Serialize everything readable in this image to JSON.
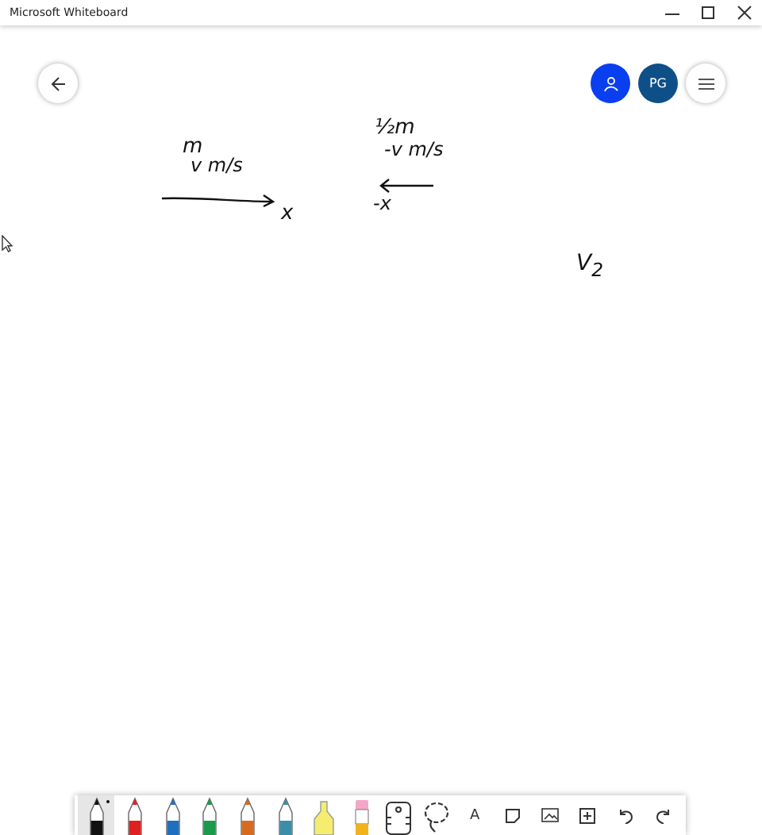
{
  "window": {
    "title": "Microsoft Whiteboard"
  },
  "top_buttons": [
    {
      "kind": "back"
    },
    {
      "kind": "person"
    },
    {
      "kind": "avatar",
      "label": "PG"
    },
    {
      "kind": "menu"
    }
  ],
  "ink": [
    {
      "kind": "text",
      "text": "m"
    },
    {
      "kind": "text",
      "text": "v m/s"
    },
    {
      "kind": "arrow-right"
    },
    {
      "kind": "text",
      "text": "x"
    },
    {
      "kind": "text",
      "text": "½m"
    },
    {
      "kind": "text",
      "text": "-v m/s"
    },
    {
      "kind": "arrow-left"
    },
    {
      "kind": "text",
      "text": "-x"
    },
    {
      "kind": "text",
      "text": "V$_{2}$"
    }
  ],
  "toolbar": [
    {
      "kind": "pen",
      "color": "#111111",
      "selected": true
    },
    {
      "kind": "pen",
      "color": "#e02020",
      "selected": false
    },
    {
      "kind": "pen",
      "color": "#1f6fc0",
      "selected": false
    },
    {
      "kind": "pen",
      "color": "#1a9a4a",
      "selected": false
    },
    {
      "kind": "pen",
      "color": "#d86a20",
      "selected": false
    },
    {
      "kind": "pen",
      "color": "#3a8fa8",
      "selected": false
    },
    {
      "kind": "highlighter",
      "color": "#f5ec70",
      "selected": false
    },
    {
      "kind": "eraser",
      "selected": false
    },
    {
      "kind": "ruler",
      "selected": false
    },
    {
      "kind": "lasso",
      "selected": false
    },
    {
      "kind": "text",
      "label": "A",
      "selected": false
    },
    {
      "kind": "note",
      "selected": false
    },
    {
      "kind": "image",
      "selected": false
    },
    {
      "kind": "add",
      "selected": false
    },
    {
      "kind": "undo",
      "selected": false
    },
    {
      "kind": "redo",
      "selected": false
    }
  ]
}
